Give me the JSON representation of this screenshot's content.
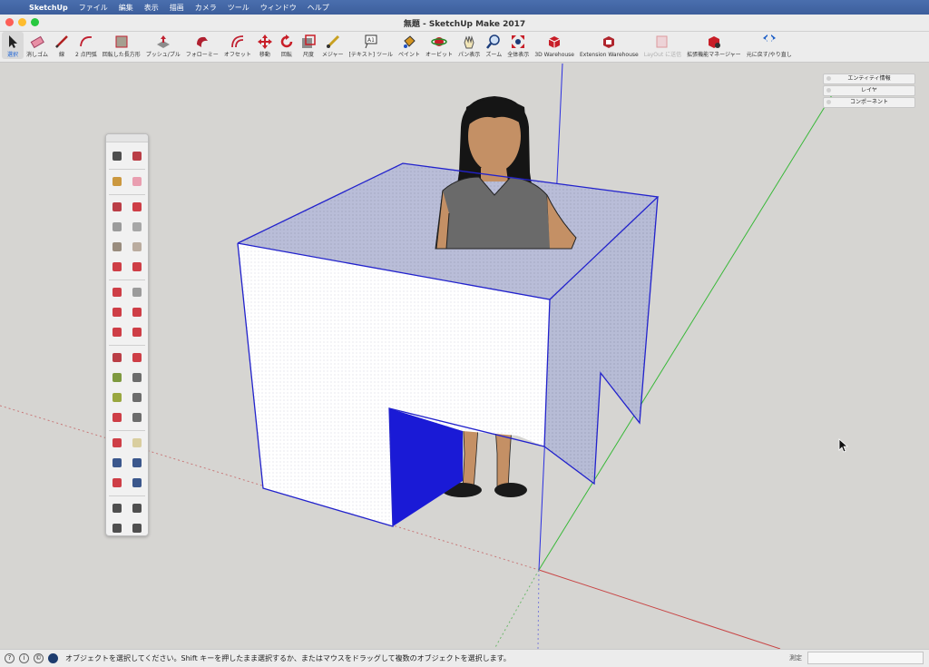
{
  "menubar": {
    "app_name": "SketchUp",
    "items": [
      "ファイル",
      "編集",
      "表示",
      "描画",
      "カメラ",
      "ツール",
      "ウィンドウ",
      "ヘルプ"
    ]
  },
  "window": {
    "title": "無題 - SketchUp Make 2017",
    "traffic_colors": [
      "#fd5f57",
      "#febc2e",
      "#28c840"
    ]
  },
  "toolbar": {
    "tools": [
      {
        "label": "選択",
        "icon": "select-arrow-icon",
        "active": true
      },
      {
        "label": "消しゴム",
        "icon": "eraser-icon"
      },
      {
        "label": "線",
        "icon": "pencil-line-icon"
      },
      {
        "label": "2 点円弧",
        "icon": "arc-icon"
      },
      {
        "label": "回転した長方形",
        "icon": "rotated-rectangle-icon"
      },
      {
        "label": "プッシュ/プル",
        "icon": "push-pull-icon"
      },
      {
        "label": "フォローミー",
        "icon": "follow-me-icon"
      },
      {
        "label": "オフセット",
        "icon": "offset-icon"
      },
      {
        "label": "移動",
        "icon": "move-icon"
      },
      {
        "label": "回転",
        "icon": "rotate-icon"
      },
      {
        "label": "尺度",
        "icon": "scale-icon"
      },
      {
        "label": "メジャー",
        "icon": "tape-measure-icon"
      },
      {
        "label": "[テキスト] ツール",
        "icon": "text-tool-icon"
      },
      {
        "label": "ペイント",
        "icon": "paint-bucket-icon"
      },
      {
        "label": "オービット",
        "icon": "orbit-icon"
      },
      {
        "label": "パン表示",
        "icon": "pan-hand-icon"
      },
      {
        "label": "ズーム",
        "icon": "zoom-magnifier-icon"
      },
      {
        "label": "全体表示",
        "icon": "zoom-extents-icon"
      },
      {
        "label": "3D Warehouse",
        "icon": "warehouse-icon"
      },
      {
        "label": "Extension Warehouse",
        "icon": "extension-warehouse-icon"
      },
      {
        "label": "LayOut に送信",
        "icon": "layout-send-icon",
        "disabled": true
      },
      {
        "label": "拡張機能マネージャー",
        "icon": "extension-manager-icon"
      },
      {
        "label": "元に戻す/やり直し",
        "icon": "undo-redo-icon"
      }
    ]
  },
  "tray": {
    "panels": [
      "エンティティ情報",
      "レイヤ",
      "コンポーネント"
    ]
  },
  "palette": {
    "tools": [
      "select-icon",
      "component-icon",
      "paint-icon",
      "eraser-icon",
      "line-icon",
      "freehand-icon",
      "rectangle-icon",
      "rotated-rect-icon",
      "circle-icon",
      "polygon-icon",
      "arc-icon",
      "two-point-arc-icon",
      "three-point-arc-icon",
      "pie-icon",
      "move-icon",
      "pushpull-icon",
      "rotate-icon",
      "followme-icon",
      "scale-icon",
      "offset-icon",
      "tape-icon",
      "dimension-icon",
      "protractor-icon",
      "text-icon",
      "axes-icon",
      "3d-text-icon",
      "orbit-icon",
      "pan-icon",
      "zoom-icon",
      "zoom-window-icon",
      "zoom-extents-icon",
      "previous-view-icon",
      "position-camera-icon",
      "walk-icon",
      "look-around-icon",
      "section-plane-icon"
    ]
  },
  "status": {
    "message": "オブジェクトを選択してください。Shift キーを押したまま選択するか、またはマウスをドラッグして複数のオブジェクトを選択します。",
    "measure_label": "測定",
    "measure_value": ""
  },
  "colors": {
    "blue_axis": "#2a2ee0",
    "green_axis": "#38b838",
    "red_axis": "#c84545",
    "face_blue": "#1a1ad6",
    "face_green": "#0f6e1e",
    "box_edge": "#2222cc"
  }
}
